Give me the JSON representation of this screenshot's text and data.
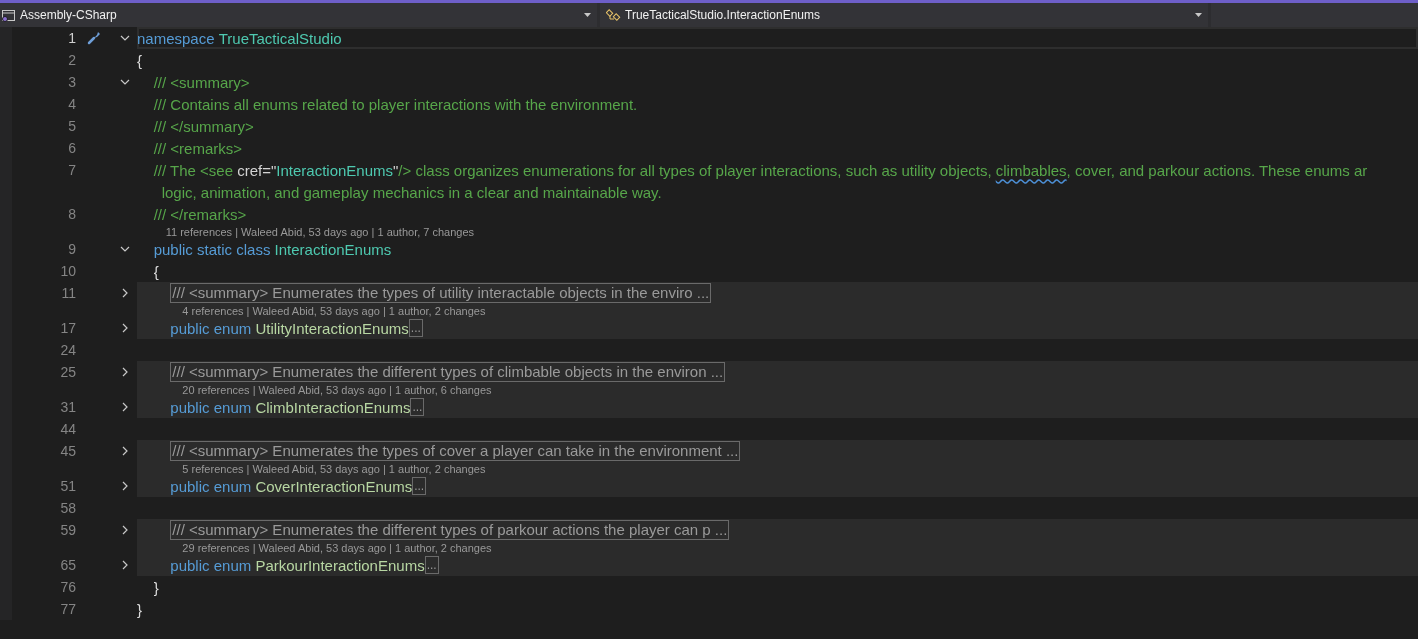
{
  "navigation_bar": [
    {
      "kind": "project",
      "label": "Assembly-CSharp"
    },
    {
      "kind": "class",
      "label": "TrueTacticalStudio.InteractionEnums"
    },
    {
      "kind": "empty"
    }
  ],
  "editor": {
    "lines": [
      {
        "number": "1",
        "expanded": true,
        "current": true,
        "quick_actions": true,
        "tokens": [
          {
            "kind": "keyword",
            "text": "namespace "
          },
          {
            "kind": "type",
            "text": "TrueTacticalStudio"
          }
        ]
      },
      {
        "number": "2",
        "tokens": [
          {
            "kind": "plain",
            "text": "{"
          }
        ]
      },
      {
        "number": "3",
        "expanded": true,
        "tokens": [
          {
            "kind": "comment",
            "text": "    /// <summary>"
          }
        ]
      },
      {
        "number": "4",
        "tokens": [
          {
            "kind": "comment",
            "text": "    /// Contains all enums related to player interactions with the environment."
          }
        ]
      },
      {
        "number": "5",
        "tokens": [
          {
            "kind": "comment",
            "text": "    /// </summary>"
          }
        ]
      },
      {
        "number": "6",
        "tokens": [
          {
            "kind": "comment",
            "text": "    /// <remarks>"
          }
        ]
      },
      {
        "number": "7",
        "tokens": [
          {
            "kind": "comment",
            "text": "    /// The <see "
          },
          {
            "kind": "attribute",
            "text": "cref=\""
          },
          {
            "kind": "string",
            "text": "InteractionEnums"
          },
          {
            "kind": "attribute",
            "text": "\""
          },
          {
            "kind": "comment",
            "text": "/> class organizes enumerations for all types of player interactions, such as utility objects, "
          },
          {
            "kind": "misspelled",
            "text": "climbables"
          },
          {
            "kind": "comment",
            "text": ", cover, and parkour actions. These enums ar"
          }
        ],
        "wrapped": [
          {
            "kind": "comment",
            "text": "logic, animation, and gameplay mechanics in a clear and maintainable way."
          }
        ]
      },
      {
        "number": "8",
        "tokens": [
          {
            "kind": "comment",
            "text": "    /// </remarks>"
          }
        ]
      },
      {
        "number": "9",
        "expanded": true,
        "codelens": "11 references | Waleed Abid, 53 days ago | 1 author, 7 changes",
        "tokens": [
          {
            "kind": "keyword",
            "text": "    public static class "
          },
          {
            "kind": "type",
            "text": "InteractionEnums"
          }
        ]
      },
      {
        "number": "10",
        "tokens": [
          {
            "kind": "plain",
            "text": "    {"
          }
        ]
      },
      {
        "number": "11",
        "expanded": false,
        "shaded": true,
        "tokens": [
          {
            "kind": "collapsed",
            "text": "        /// <summary> Enumerates the types of utility interactable objects in the enviro ..."
          }
        ]
      },
      {
        "number": "17",
        "expanded": false,
        "shaded": true,
        "codelens": "4 references | Waleed Abid, 53 days ago | 1 author, 2 changes",
        "tokens": [
          {
            "kind": "keyword",
            "text": "        public enum "
          },
          {
            "kind": "enum",
            "text": "UtilityInteractionEnums"
          },
          {
            "kind": "ellipsis",
            "text": "..."
          }
        ]
      },
      {
        "number": "24"
      },
      {
        "number": "25",
        "expanded": false,
        "shaded": true,
        "tokens": [
          {
            "kind": "collapsed",
            "text": "        /// <summary> Enumerates the different types of climbable objects in the environ ..."
          }
        ]
      },
      {
        "number": "31",
        "expanded": false,
        "shaded": true,
        "codelens": "20 references | Waleed Abid, 53 days ago | 1 author, 6 changes",
        "tokens": [
          {
            "kind": "keyword",
            "text": "        public enum "
          },
          {
            "kind": "enum",
            "text": "ClimbInteractionEnums"
          },
          {
            "kind": "ellipsis",
            "text": "..."
          }
        ]
      },
      {
        "number": "44"
      },
      {
        "number": "45",
        "expanded": false,
        "shaded": true,
        "tokens": [
          {
            "kind": "collapsed",
            "text": "        /// <summary> Enumerates the types of cover a player can take in the environment ..."
          }
        ]
      },
      {
        "number": "51",
        "expanded": false,
        "shaded": true,
        "codelens": "5 references | Waleed Abid, 53 days ago | 1 author, 2 changes",
        "tokens": [
          {
            "kind": "keyword",
            "text": "        public enum "
          },
          {
            "kind": "enum",
            "text": "CoverInteractionEnums"
          },
          {
            "kind": "ellipsis",
            "text": "..."
          }
        ]
      },
      {
        "number": "58"
      },
      {
        "number": "59",
        "expanded": false,
        "shaded": true,
        "tokens": [
          {
            "kind": "collapsed",
            "text": "        /// <summary> Enumerates the different types of parkour actions the player can p ..."
          }
        ]
      },
      {
        "number": "65",
        "expanded": false,
        "shaded": true,
        "codelens": "29 references | Waleed Abid, 53 days ago | 1 author, 2 changes",
        "tokens": [
          {
            "kind": "keyword",
            "text": "        public enum "
          },
          {
            "kind": "enum",
            "text": "ParkourInteractionEnums"
          },
          {
            "kind": "ellipsis",
            "text": "..."
          }
        ]
      },
      {
        "number": "76",
        "tokens": [
          {
            "kind": "plain",
            "text": "    }"
          }
        ]
      },
      {
        "number": "77",
        "tokens": [
          {
            "kind": "plain",
            "text": "}"
          }
        ]
      }
    ]
  }
}
